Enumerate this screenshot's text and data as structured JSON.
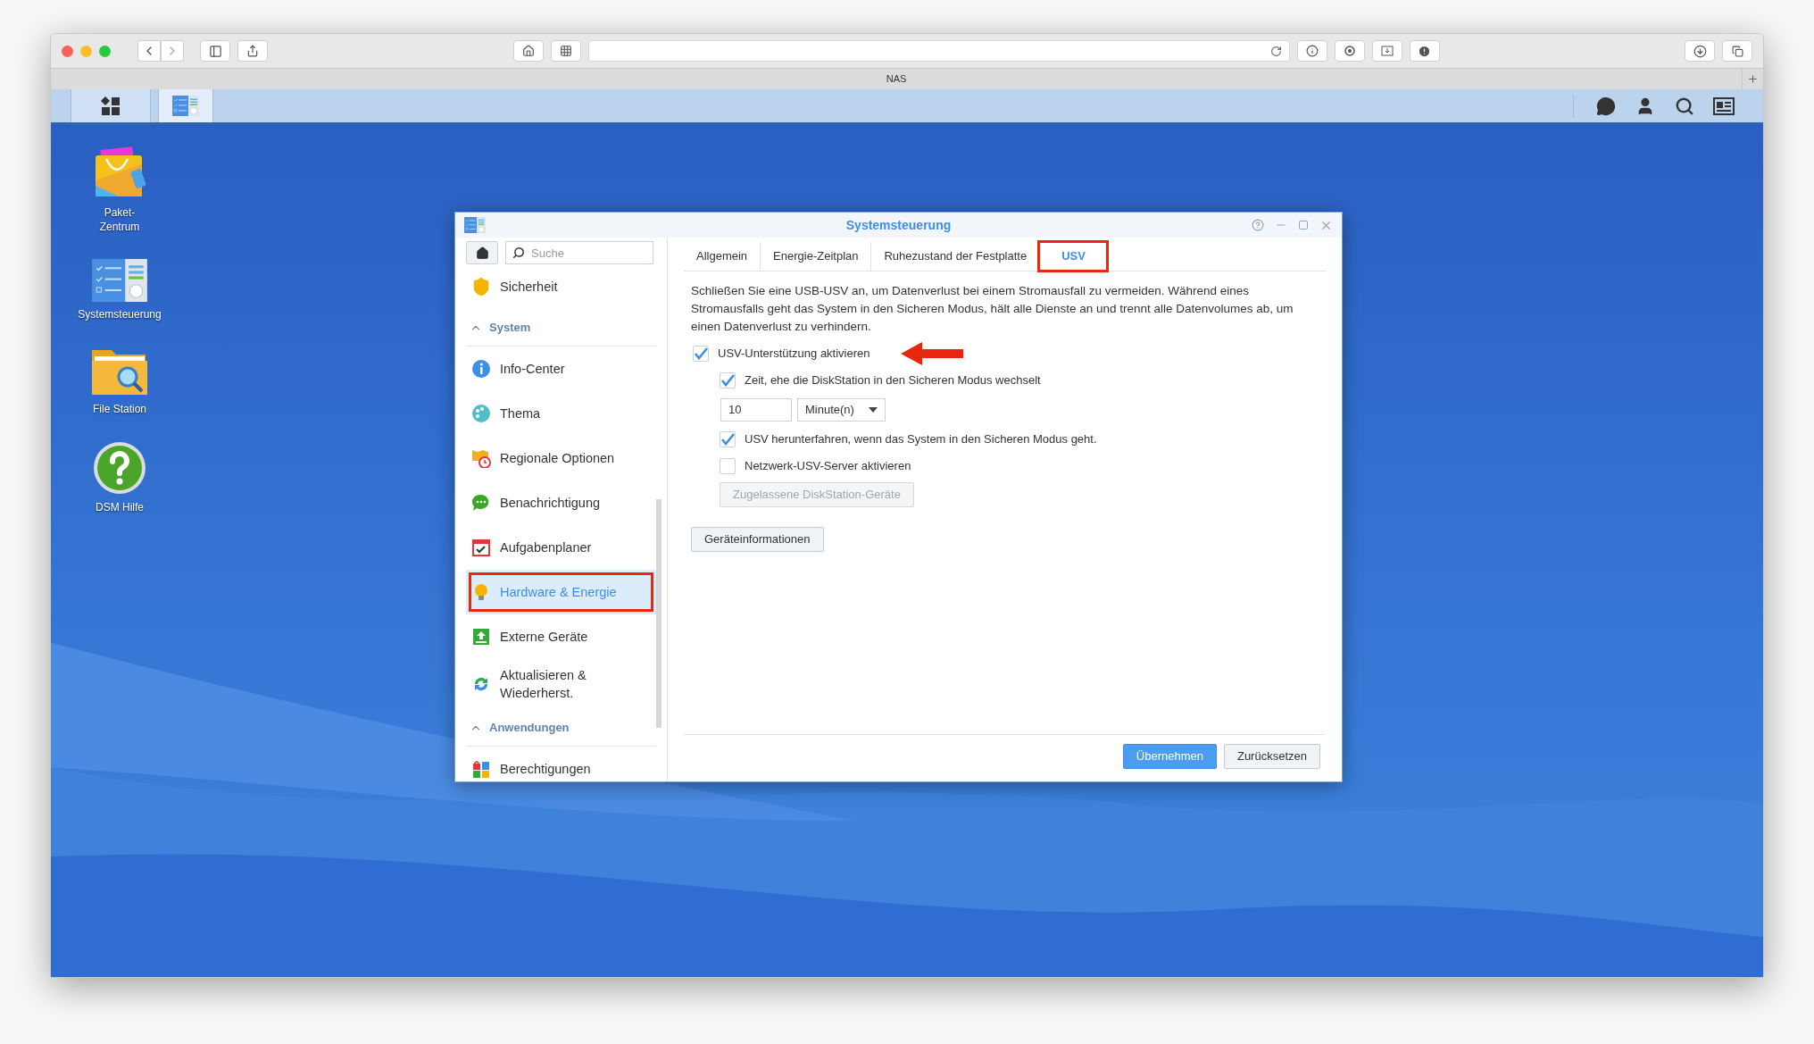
{
  "browser": {
    "tab_title": "NAS"
  },
  "taskbar": {
    "buttons": [
      {
        "kind": "main-menu",
        "selected": false
      },
      {
        "kind": "control-panel",
        "selected": true
      }
    ]
  },
  "desktop_icons": [
    {
      "kind": "package",
      "label_lines": [
        "Paket-",
        "Zentrum"
      ]
    },
    {
      "kind": "control-panel",
      "label_lines": [
        "Systemsteuerung"
      ]
    },
    {
      "kind": "file-station",
      "label_lines": [
        "File Station"
      ]
    },
    {
      "kind": "help",
      "label_lines": [
        "DSM Hilfe"
      ]
    }
  ],
  "window": {
    "title": "Systemsteuerung",
    "search": {
      "placeholder": "Suche"
    },
    "sidebar": [
      {
        "kind": "item",
        "label": "Sicherheit",
        "selected": false,
        "highlighted": false
      },
      {
        "kind": "section",
        "label": "System",
        "expanded": true
      },
      {
        "kind": "item",
        "label": "Info-Center",
        "selected": false,
        "highlighted": false
      },
      {
        "kind": "item",
        "label": "Thema",
        "selected": false,
        "highlighted": false
      },
      {
        "kind": "item",
        "label": "Regionale Optionen",
        "selected": false,
        "highlighted": false
      },
      {
        "kind": "item",
        "label": "Benachrichtigung",
        "selected": false,
        "highlighted": false
      },
      {
        "kind": "item",
        "label": "Aufgabenplaner",
        "selected": false,
        "highlighted": false
      },
      {
        "kind": "item",
        "label": "Hardware & Energie",
        "selected": true,
        "highlighted": true
      },
      {
        "kind": "item",
        "label": "Externe Geräte",
        "selected": false,
        "highlighted": false
      },
      {
        "kind": "item",
        "label": "Aktualisieren & Wiederherst.",
        "selected": false,
        "highlighted": false
      },
      {
        "kind": "section",
        "label": "Anwendungen",
        "expanded": true
      },
      {
        "kind": "item",
        "label": "Berechtigungen",
        "selected": false,
        "highlighted": false
      }
    ],
    "tabs": [
      {
        "label": "Allgemein",
        "selected": false,
        "highlighted": false
      },
      {
        "label": "Energie-Zeitplan",
        "selected": false,
        "highlighted": false
      },
      {
        "label": "Ruhezustand der Festplatte",
        "selected": false,
        "highlighted": false
      },
      {
        "label": "USV",
        "selected": true,
        "highlighted": true
      }
    ],
    "description": "Schließen Sie eine USB-USV an, um Datenverlust bei einem Stromausfall zu vermeiden. Während eines Stromausfalls geht das System in den Sicheren Modus, hält alle Dienste an und trennt alle Datenvolumes ab, um einen Datenverlust zu verhindern.",
    "options": [
      {
        "kind": "checkbox",
        "label": "USV-Unterstützung aktivieren",
        "checked": true,
        "children": [
          {
            "kind": "checkbox",
            "label": "Zeit, ehe die DiskStation in den Sicheren Modus wechselt",
            "checked": true
          },
          {
            "kind": "duration",
            "value": "10",
            "unit": "Minute(n)"
          },
          {
            "kind": "checkbox",
            "label": "USV herunterfahren, wenn das System in den Sicheren Modus geht.",
            "checked": true
          },
          {
            "kind": "checkbox",
            "label": "Netzwerk-USV-Server aktivieren",
            "checked": false
          },
          {
            "kind": "button",
            "label": "Zugelassene DiskStation-Geräte",
            "disabled": true
          }
        ]
      }
    ],
    "info_button": "Geräteinformationen",
    "footer_buttons": [
      {
        "kind": "primary",
        "label": "Übernehmen"
      },
      {
        "kind": "secondary",
        "label": "Zurücksetzen"
      }
    ]
  }
}
